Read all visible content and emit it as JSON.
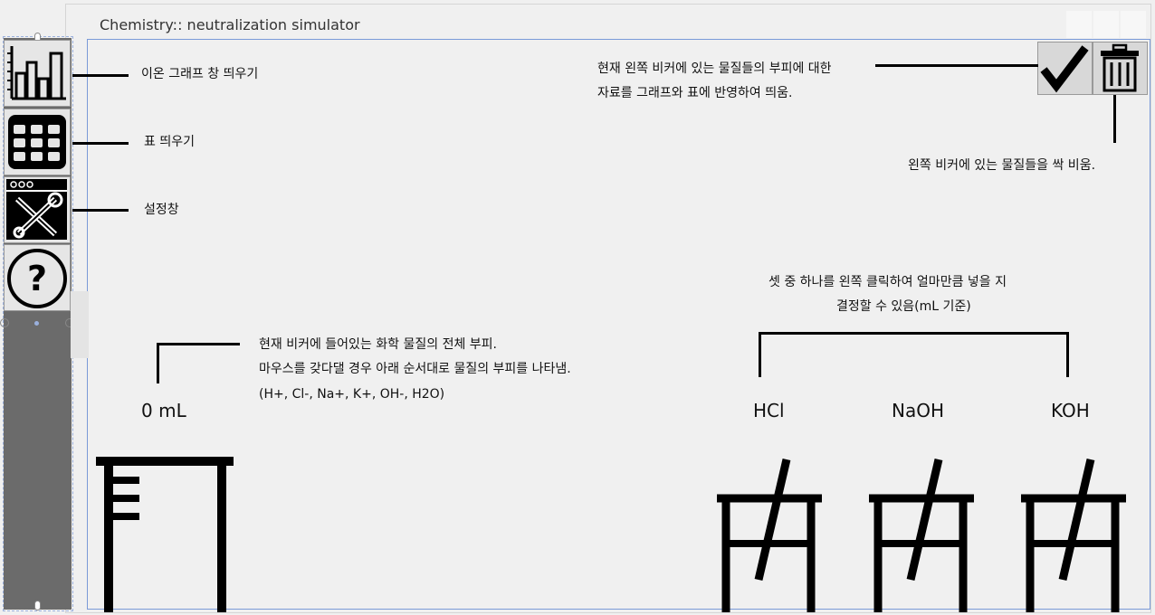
{
  "window": {
    "title": "Chemistry:: neutralization simulator"
  },
  "toolbar": {
    "buttons": [
      {
        "icon": "bar-chart-icon",
        "note": "이온 그래프 창 띄우기"
      },
      {
        "icon": "table-icon",
        "note": "표 띄우기"
      },
      {
        "icon": "tools-icon",
        "note": "설정창"
      },
      {
        "icon": "help-icon",
        "note": ""
      }
    ]
  },
  "top_actions": {
    "confirm_note_line1": "현재 왼쪽 비커에 있는 물질들의 부피에 대한",
    "confirm_note_line2": "자료를 그래프와 표에 반영하여 띄움.",
    "trash_note": "왼쪽 비커에 있는 물질들을 싹 비움."
  },
  "beaker": {
    "volume_value": "0 mL",
    "note_line1": "현재 비커에 들어있는 화학 물질의 전체 부피.",
    "note_line2": "마우스를 갖다댈 경우 아래 순서대로 물질의 부피를 나타냄.",
    "note_line3": "(H+, Cl-, Na+, K+, OH-, H2O)"
  },
  "reagents": {
    "note_line1": "셋 중 하나를 왼쪽 클릭하여 얼마만큼 넣을 지",
    "note_line2": "결정할 수 있음(mL 기준)",
    "items": [
      "HCl",
      "NaOH",
      "KOH"
    ]
  }
}
